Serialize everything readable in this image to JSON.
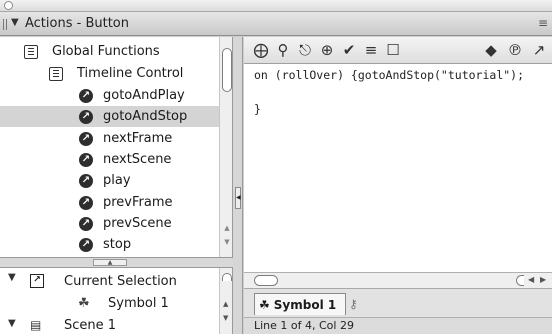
{
  "panel": {
    "title": "Actions - Button",
    "collapse_arrow": "▼",
    "menu_icon": "options-menu-icon"
  },
  "tree": {
    "items": [
      {
        "label": "Global Functions",
        "icon": "book-icon"
      },
      {
        "label": "Timeline Control",
        "icon": "book-icon"
      },
      {
        "label": "gotoAndPlay",
        "icon": "action-icon"
      },
      {
        "label": "gotoAndStop",
        "icon": "action-icon",
        "selected": true
      },
      {
        "label": "nextFrame",
        "icon": "action-icon"
      },
      {
        "label": "nextScene",
        "icon": "action-icon"
      },
      {
        "label": "play",
        "icon": "action-icon"
      },
      {
        "label": "prevFrame",
        "icon": "action-icon"
      },
      {
        "label": "prevScene",
        "icon": "action-icon"
      },
      {
        "label": "stop",
        "icon": "action-icon"
      }
    ]
  },
  "navigator": {
    "current_selection": "Current Selection",
    "symbol": "Symbol 1",
    "scene": "Scene 1"
  },
  "toolbar": {
    "icons": [
      "add-action-icon",
      "find-icon",
      "replace-icon",
      "target-icon",
      "check-syntax-icon",
      "auto-format-icon",
      "code-hint-icon",
      "debug-options-icon",
      "reference-icon",
      "script-assist-icon"
    ]
  },
  "editor": {
    "lines": [
      "on (rollOver) {gotoAndStop(\"tutorial\");",
      "",
      "}"
    ]
  },
  "script_tab": {
    "label": "Symbol 1"
  },
  "status": {
    "text": "Line 1 of 4, Col 29"
  }
}
